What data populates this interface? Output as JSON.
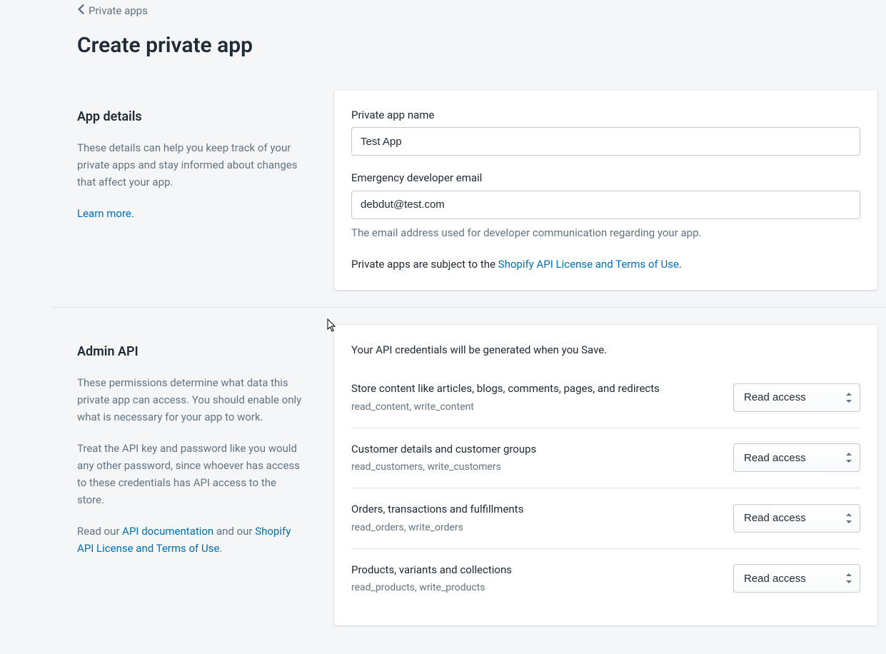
{
  "breadcrumb": {
    "label": "Private apps"
  },
  "page_title": "Create private app",
  "app_details": {
    "heading": "App details",
    "description": "These details can help you keep track of your private apps and stay informed about changes that affect your app.",
    "learn_more": "Learn more.",
    "name_label": "Private app name",
    "name_value": "Test App",
    "email_label": "Emergency developer email",
    "email_value": "debdut@test.com",
    "email_help": "The email address used for developer communication regarding your app.",
    "legal_prefix": "Private apps are subject to the ",
    "legal_link": "Shopify API License and Terms of Use",
    "legal_suffix": "."
  },
  "admin_api": {
    "heading": "Admin API",
    "description": "These permissions determine what data this private app can access. You should enable only what is necessary for your app to work.",
    "security_note": "Treat the API key and password like you would any other password, since whoever has access to these credentials has API access to the store.",
    "docs_prefix": "Read our ",
    "docs_link": "API documentation",
    "docs_mid": " and our ",
    "license_link": "Shopify API License and Terms of Use",
    "docs_suffix": ".",
    "card_intro": "Your API credentials will be generated when you Save.",
    "select_value": "Read access",
    "permissions": [
      {
        "title": "Store content like articles, blogs, comments, pages, and redirects",
        "scopes": "read_content, write_content"
      },
      {
        "title": "Customer details and customer groups",
        "scopes": "read_customers, write_customers"
      },
      {
        "title": "Orders, transactions and fulfillments",
        "scopes": "read_orders, write_orders"
      },
      {
        "title": "Products, variants and collections",
        "scopes": "read_products, write_products"
      }
    ]
  }
}
